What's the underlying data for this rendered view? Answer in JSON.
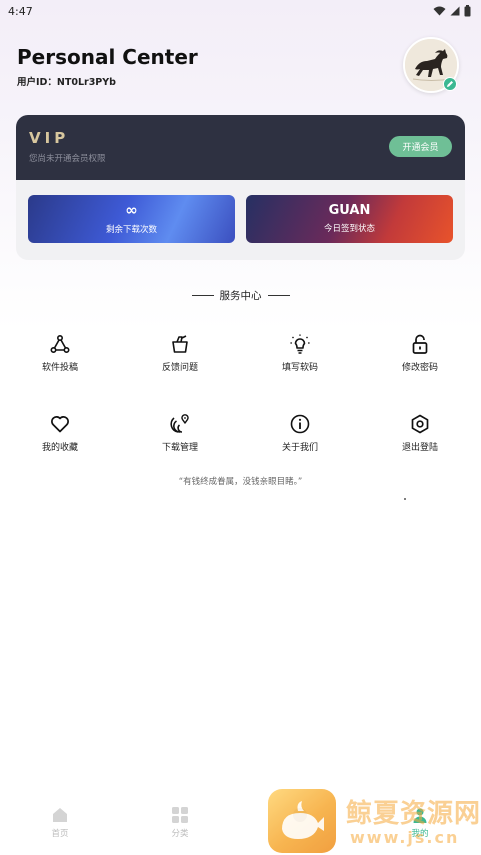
{
  "status_bar": {
    "time": "4:47"
  },
  "profile": {
    "title": "Personal Center",
    "user_id_label": "用户ID：",
    "user_id": "NT0Lr3PYb"
  },
  "vip": {
    "title": "VIP",
    "subtitle": "您尚未开通会员权限",
    "button_label": "开通会员",
    "stats": [
      {
        "value": "∞",
        "label": "剩余下载次数"
      },
      {
        "value": "GUAN",
        "label": "今日签到状态"
      }
    ]
  },
  "services": {
    "title": "服务中心",
    "items": [
      {
        "label": "软件投稿",
        "icon": "share-icon"
      },
      {
        "label": "反馈问题",
        "icon": "feedback-icon"
      },
      {
        "label": "填写软码",
        "icon": "lightbulb-icon"
      },
      {
        "label": "修改密码",
        "icon": "lock-icon"
      },
      {
        "label": "我的收藏",
        "icon": "heart-icon"
      },
      {
        "label": "下载管理",
        "icon": "location-icon"
      },
      {
        "label": "关于我们",
        "icon": "info-icon"
      },
      {
        "label": "退出登陆",
        "icon": "hexagon-icon"
      }
    ]
  },
  "quote": "“有钱终成眷属，没钱亲眼目睹。”",
  "bottom_nav": {
    "items": [
      {
        "label": "首页",
        "icon": "home-icon",
        "active": false
      },
      {
        "label": "分类",
        "icon": "grid-icon",
        "active": false
      },
      {
        "label": "",
        "icon": "tab-icon",
        "active": false
      },
      {
        "label": "我的",
        "icon": "user-icon",
        "active": true
      }
    ]
  },
  "watermark": {
    "text": "鲸夏资源网",
    "url": "www.js.cn"
  },
  "colors": {
    "accent": "#3bb892",
    "vip_header": "#2e3141",
    "vip_gold": "#d8c79e"
  }
}
